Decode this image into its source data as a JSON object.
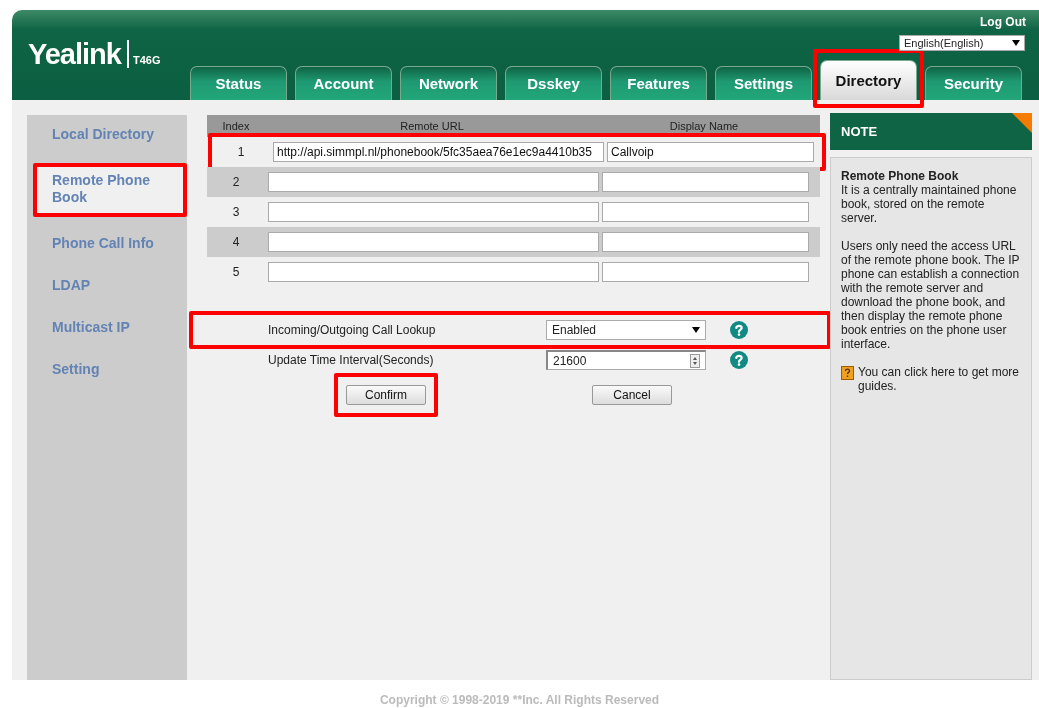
{
  "header": {
    "logo": "Yealink",
    "model": "T46G",
    "logout": "Log Out",
    "language": "English(English)"
  },
  "tabs": [
    {
      "label": "Status",
      "selected": false,
      "highlighted": false
    },
    {
      "label": "Account",
      "selected": false,
      "highlighted": false
    },
    {
      "label": "Network",
      "selected": false,
      "highlighted": false
    },
    {
      "label": "Dsskey",
      "selected": false,
      "highlighted": false
    },
    {
      "label": "Features",
      "selected": false,
      "highlighted": false
    },
    {
      "label": "Settings",
      "selected": false,
      "highlighted": false
    },
    {
      "label": "Directory",
      "selected": true,
      "highlighted": true
    },
    {
      "label": "Security",
      "selected": false,
      "highlighted": false
    }
  ],
  "sidebar": {
    "items": [
      {
        "label": "Local Directory",
        "selected": false,
        "highlighted": false
      },
      {
        "label": "Remote Phone Book",
        "selected": true,
        "highlighted": true
      },
      {
        "label": "Phone Call Info",
        "selected": false,
        "highlighted": false
      },
      {
        "label": "LDAP",
        "selected": false,
        "highlighted": false
      },
      {
        "label": "Multicast IP",
        "selected": false,
        "highlighted": false
      },
      {
        "label": "Setting",
        "selected": false,
        "highlighted": false
      }
    ]
  },
  "table": {
    "columns": [
      "Index",
      "Remote URL",
      "Display Name"
    ],
    "rows": [
      {
        "index": "1",
        "url": "http://api.simmpl.nl/phonebook/5fc35aea76e1ec9a4410b35",
        "name": "Callvoip",
        "highlighted": true
      },
      {
        "index": "2",
        "highlighted": false
      },
      {
        "index": "3",
        "highlighted": false
      },
      {
        "index": "4",
        "highlighted": false
      },
      {
        "index": "5",
        "highlighted": false
      }
    ]
  },
  "settings": [
    {
      "label": "Incoming/Outgoing Call Lookup",
      "kind": "select",
      "value": "Enabled",
      "highlighted": true
    },
    {
      "label": "Update Time Interval(Seconds)",
      "kind": "spin",
      "value": "21600",
      "highlighted": false
    }
  ],
  "buttons": [
    {
      "label": "Confirm",
      "highlighted": true
    },
    {
      "label": "Cancel",
      "highlighted": false
    }
  ],
  "note": {
    "title": "NOTE",
    "heading": "Remote Phone Book",
    "paragraphs": [
      "It is a centrally maintained phone book, stored on the remote server.",
      "Users only need the access URL of the remote phone book. The IP phone can establish a connection with the remote server and download the phone book, and then display the remote phone book entries on the phone user interface."
    ],
    "guide": "You can click here to get more guides."
  },
  "footer": "Copyright © 1998-2019 **Inc. All Rights Reserved"
}
